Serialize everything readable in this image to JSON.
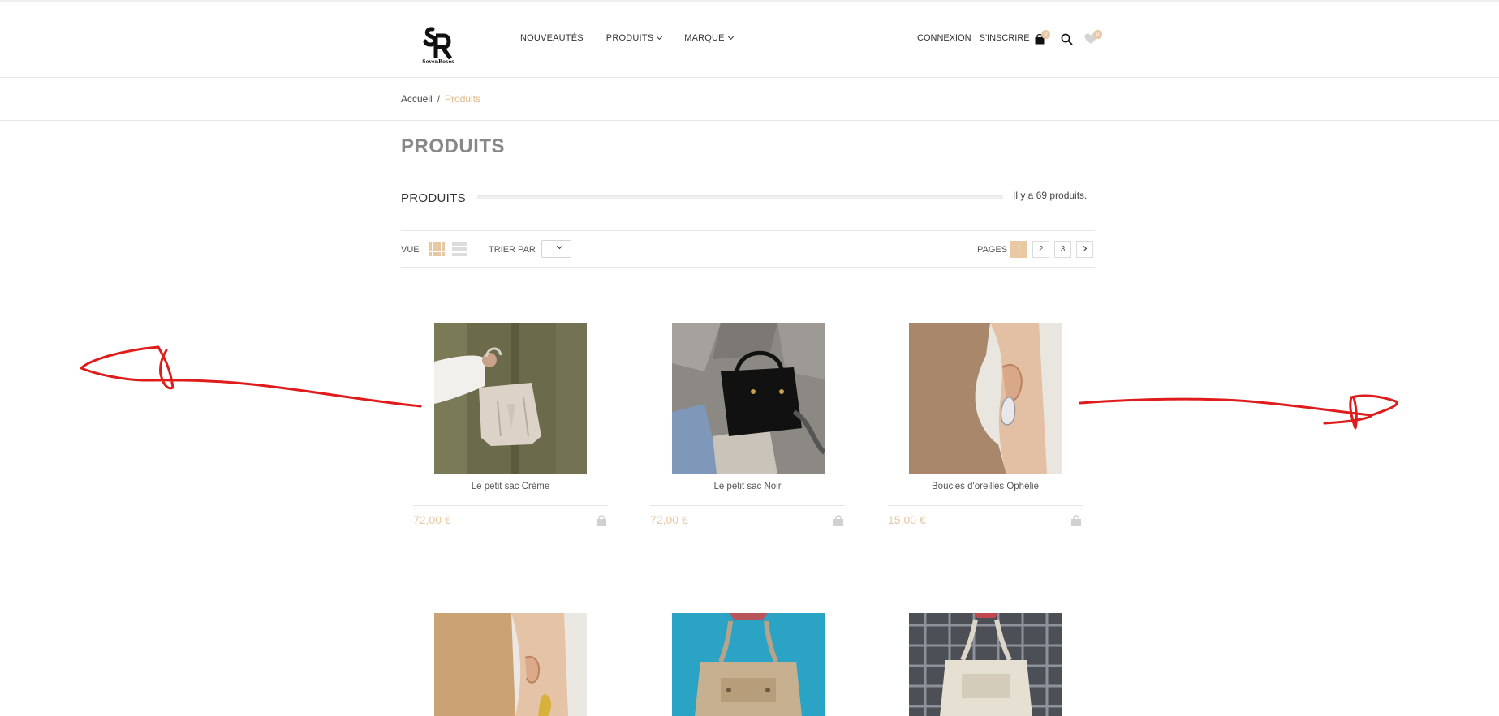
{
  "header": {
    "logo_alt": "SevenRoses",
    "nav": [
      {
        "label": "NOUVEAUTÉS",
        "has_dropdown": false
      },
      {
        "label": "PRODUITS",
        "has_dropdown": true
      },
      {
        "label": "MARQUE",
        "has_dropdown": true
      }
    ],
    "login_label": "CONNEXION",
    "signup_label": "S'INSCRIRE",
    "cart_count": "0",
    "wishlist_count": "0",
    "icons": {
      "cart": "shopping-bag-icon",
      "search": "search-icon",
      "wishlist": "heart-icon"
    }
  },
  "breadcrumb": {
    "home": "Accueil",
    "separator": "/",
    "current": "Produits"
  },
  "page": {
    "title": "PRODUITS",
    "section_title": "PRODUITS",
    "product_count": "Il y a 69 produits."
  },
  "toolbar": {
    "view_label": "VUE",
    "sort_label": "TRIER PAR",
    "sort_value": "",
    "pages_label": "PAGES",
    "pages": [
      "1",
      "2",
      "3"
    ],
    "active_page": "1"
  },
  "products": [
    {
      "name": "Le petit sac Crème",
      "price": "72,00 €"
    },
    {
      "name": "Le petit sac Noir",
      "price": "72,00 €"
    },
    {
      "name": "Boucles d'oreilles Ophélie",
      "price": "15,00 €"
    }
  ],
  "colors": {
    "accent": "#e9c9a3",
    "price": "#e8c7a0",
    "annotation": "#e01b1b",
    "title_grey": "#888888"
  }
}
